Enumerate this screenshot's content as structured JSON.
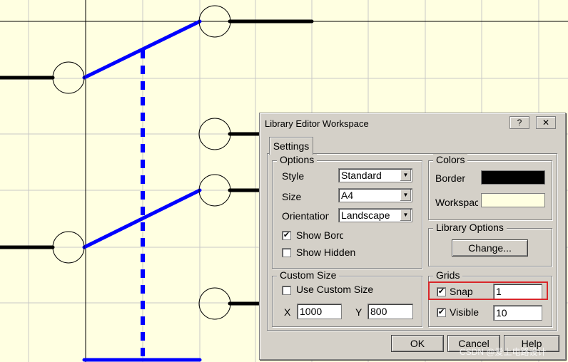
{
  "dialog": {
    "title": "Library Editor Workspace",
    "help_label": "?",
    "close_label": "✕",
    "tab_label": "Settings",
    "options": {
      "label": "Options",
      "style_label": "Style",
      "style_value": "Standard",
      "size_label": "Size",
      "size_value": "A4",
      "orientation_label": "Orientation",
      "orientation_value": "Landscape",
      "show_border_label": "Show Bord",
      "show_border_checked": true,
      "show_hidden_label": "Show Hidden",
      "show_hidden_checked": false
    },
    "colors": {
      "label": "Colors",
      "border_label": "Border",
      "border_color": "#000000",
      "workspace_label": "Workspac",
      "workspace_color": "#FFFFE1"
    },
    "library_options": {
      "label": "Library Options",
      "change_label": "Change..."
    },
    "custom_size": {
      "label": "Custom Size",
      "use_custom_label": "Use Custom Size",
      "use_custom_checked": false,
      "x_label": "X",
      "x_value": "1000",
      "y_label": "Y",
      "y_value": "800"
    },
    "grids": {
      "label": "Grids",
      "snap_label": "Snap",
      "snap_checked": true,
      "snap_value": "1",
      "visible_label": "Visible",
      "visible_checked": true,
      "visible_value": "10"
    },
    "ok_label": "OK",
    "cancel_label": "Cancel",
    "help_button_label": "Help"
  },
  "watermark": "CSDN @爱上电路设计",
  "colors": {
    "workspace_bg": "#FFFFE1",
    "wire_blue": "#0000FF",
    "pin_black": "#000000",
    "highlight_red": "#D9262A"
  }
}
